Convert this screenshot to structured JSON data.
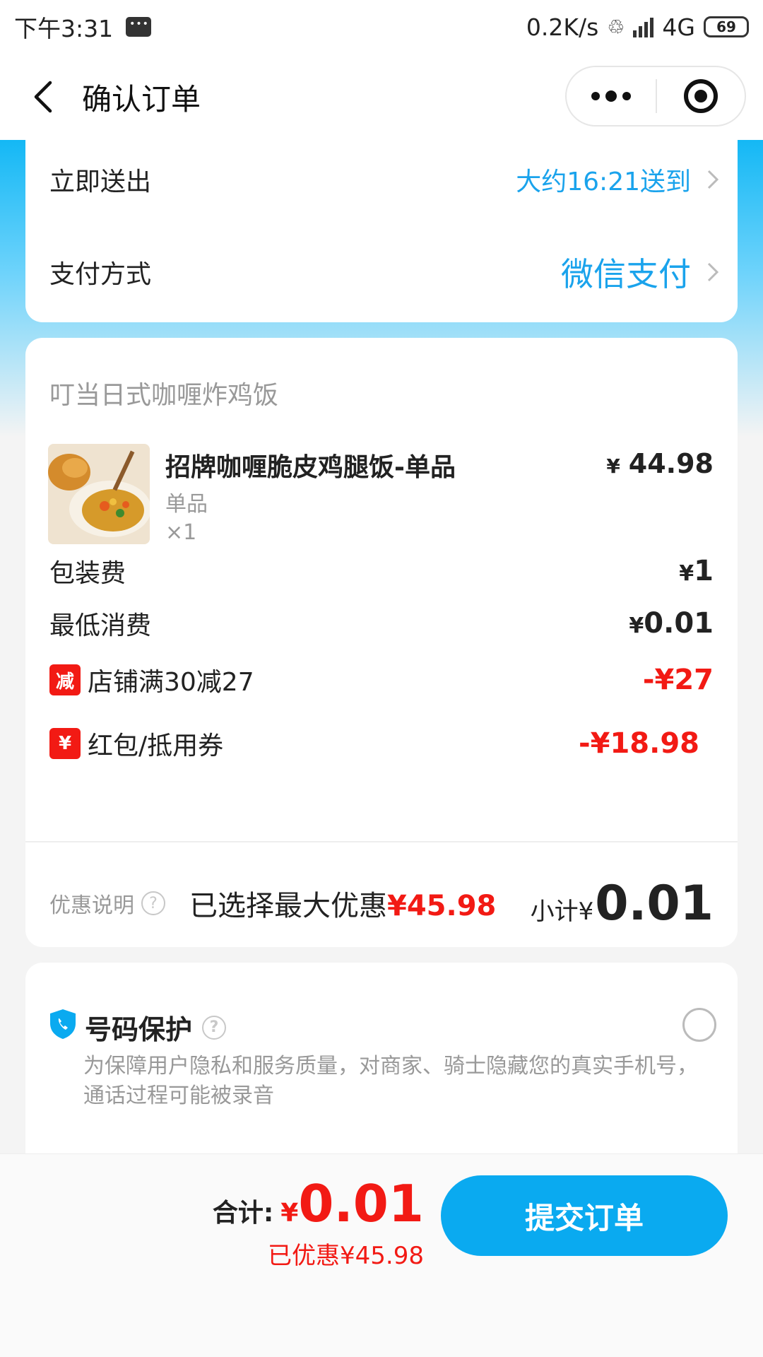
{
  "status_bar": {
    "time": "下午3:31",
    "network_speed": "0.2K/s",
    "network_type": "4G",
    "battery": "69"
  },
  "nav": {
    "title": "确认订单"
  },
  "delivery": {
    "label": "立即送出",
    "value": "大约16:21送到"
  },
  "payment": {
    "label": "支付方式",
    "value": "微信支付"
  },
  "shop": {
    "name": "叮当日式咖喱炸鸡饭"
  },
  "item": {
    "title": "招牌咖喱脆皮鸡腿饭-单品",
    "spec": "单品",
    "qty": "×1",
    "currency": "¥",
    "price": "44.98"
  },
  "fees": {
    "packing_label": "包装费",
    "packing_currency": "¥",
    "packing_amount": "1",
    "min_label": "最低消费",
    "min_currency": "¥",
    "min_amount": "0.01",
    "shop_discount_tag": "减",
    "shop_discount_label": "店铺满30减27",
    "shop_discount_amount": "-¥27",
    "coupon_tag": "¥",
    "coupon_label": "红包/抵用券",
    "coupon_amount": "-¥18.98"
  },
  "summary": {
    "note": "优惠说明",
    "qmark": "?",
    "discount_prefix": "已选择最大优惠",
    "discount_amount": "¥45.98",
    "subtotal_label": "小计¥",
    "subtotal_amount": "0.01"
  },
  "protection": {
    "title": "号码保护",
    "qmark": "?",
    "desc": "为保障用户隐私和服务质量，对商家、骑士隐藏您的真实手机号，通话过程可能被录音"
  },
  "bottom": {
    "total_label": "合计:",
    "total_currency": "¥",
    "total_amount": "0.01",
    "saved": "已优惠¥45.98",
    "submit": "提交订单"
  },
  "colors": {
    "accent_blue": "#0aaaf0",
    "link_blue": "#1aa3ec",
    "discount_red": "#f21a14"
  }
}
